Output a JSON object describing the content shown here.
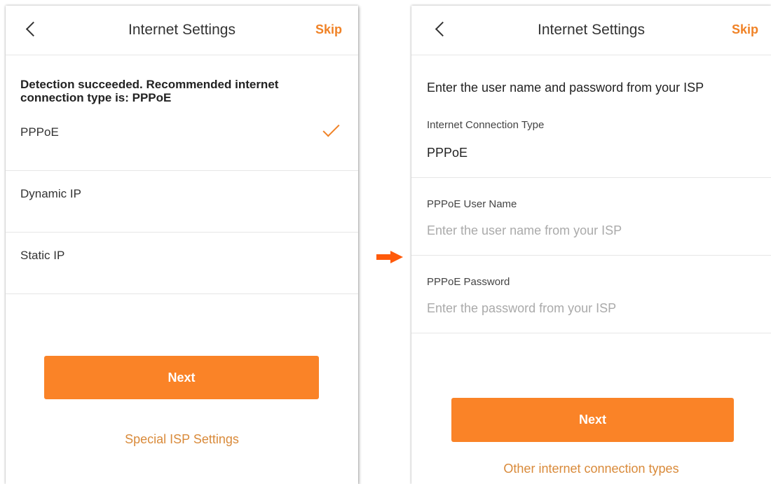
{
  "left_screen": {
    "header": {
      "title": "Internet Settings",
      "skip_label": "Skip"
    },
    "detection_message": "Detection succeeded. Recommended internet connection type is: PPPoE",
    "options": [
      {
        "label": "PPPoE",
        "selected": true
      },
      {
        "label": "Dynamic IP",
        "selected": false
      },
      {
        "label": "Static IP",
        "selected": false
      }
    ],
    "next_label": "Next",
    "special_isp_link": "Special ISP Settings"
  },
  "right_screen": {
    "header": {
      "title": "Internet Settings",
      "skip_label": "Skip"
    },
    "intro": "Enter the user name and password from your ISP",
    "connection_type": {
      "label": "Internet Connection Type",
      "value": "PPPoE"
    },
    "username": {
      "label": "PPPoE User Name",
      "value": "",
      "placeholder": "Enter the user name from your ISP"
    },
    "password": {
      "label": "PPPoE Password",
      "value": "",
      "placeholder": "Enter the password from your ISP"
    },
    "next_label": "Next",
    "other_types_link": "Other internet connection types"
  },
  "transition_icon": "arrow-right-icon",
  "colors": {
    "accent": "#FA8327",
    "link": "#D98A3A",
    "divider": "#e6e6e6",
    "arrow": "#FF5A0A"
  }
}
